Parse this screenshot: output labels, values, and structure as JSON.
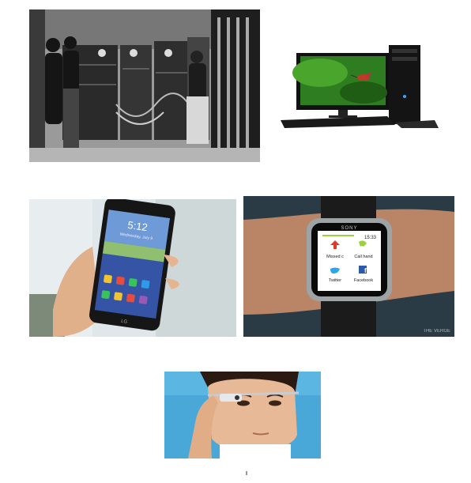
{
  "watch": {
    "brand": "SONY",
    "time": "15:33",
    "apps": [
      {
        "label": "Missed c",
        "icon": "missed-call-icon"
      },
      {
        "label": "Call hand",
        "icon": "call-handset-icon"
      },
      {
        "label": "Twitter",
        "icon": "twitter-icon"
      },
      {
        "label": "Facebook",
        "icon": "facebook-icon"
      }
    ],
    "watermark": "THE VERGE"
  },
  "phone": {
    "brand": "LG",
    "time": "5:12",
    "date": "Wednesday, July 9"
  },
  "colors": {
    "desktop_screen": "#2e7d20",
    "watch_missed": "#e03b2a",
    "watch_call": "#9bd23a",
    "twitter": "#2fa6e6",
    "facebook": "#2b5aa8"
  }
}
